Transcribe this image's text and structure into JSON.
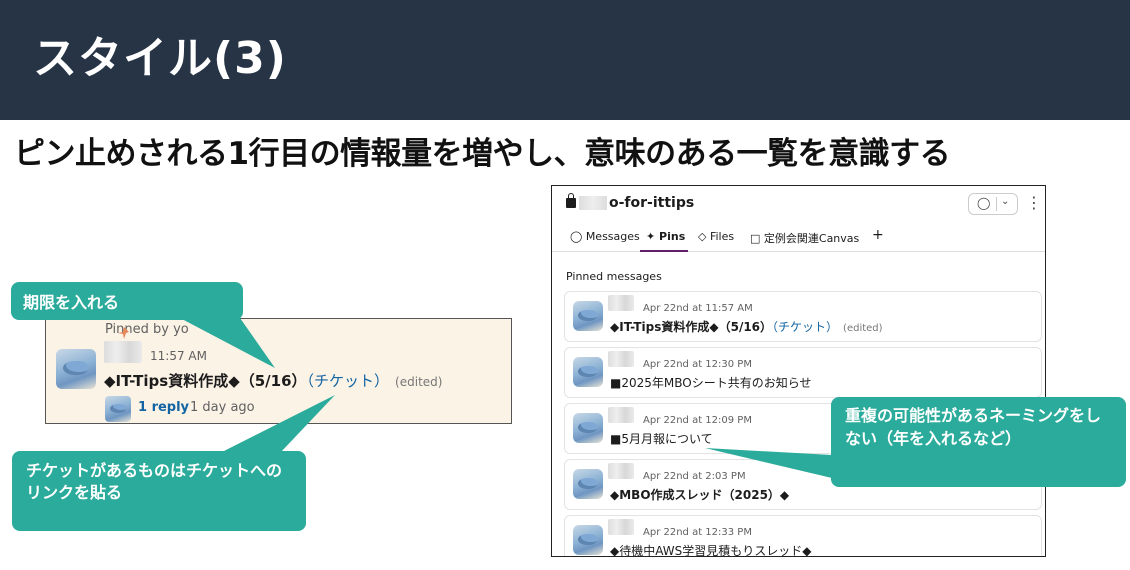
{
  "slide": {
    "title": "スタイル(3)",
    "subtitle": "ピン止めされる1行目の情報量を増やし、意味のある一覧を意識する"
  },
  "left_card": {
    "pinned_by": "Pinned by yo",
    "time": "11:57 AM",
    "message_main": "◆IT-Tips資料作成◆（5/16）",
    "message_link": "（チケット）",
    "edited": "(edited)",
    "reply_count": "1 reply",
    "reply_time": "1 day ago"
  },
  "callouts": {
    "deadline": "期限を入れる",
    "ticket_link": "チケットがあるものはチケットへのリンクを貼る",
    "naming": "重複の可能性があるネーミングをしない（年を入れるなど）"
  },
  "panel": {
    "channel_name": "o-for-ittips",
    "tabs": [
      "Messages",
      "Pins",
      "Files",
      "定例会関連Canvas",
      "+"
    ],
    "section_label": "Pinned messages",
    "messages": [
      {
        "time": "Apr 22nd at 11:57 AM",
        "text": "◆IT-Tips資料作成◆（5/16）",
        "link": "（チケット）",
        "edited": "(edited)",
        "bold": true
      },
      {
        "time": "Apr 22nd at 12:30 PM",
        "text": "■2025年MBOシート共有のお知らせ",
        "link": "",
        "edited": "",
        "bold": false
      },
      {
        "time": "Apr 22nd at 12:09 PM",
        "text": "■5月月報について",
        "link": "",
        "edited": "",
        "bold": false
      },
      {
        "time": "Apr 22nd at 2:03 PM",
        "text": "◆MBO作成スレッド（2025）◆",
        "link": "",
        "edited": "",
        "bold": true
      },
      {
        "time": "Apr 22nd at 12:33 PM",
        "text": "◆待機中AWS学習見積もりスレッド◆",
        "link": "",
        "edited": "",
        "bold": false
      }
    ]
  },
  "colors": {
    "title_bar": "#263445",
    "callout": "#2bab9b",
    "link": "#1264a3",
    "pinned_bg": "#fbf3e6",
    "active_tab": "#611f69"
  }
}
